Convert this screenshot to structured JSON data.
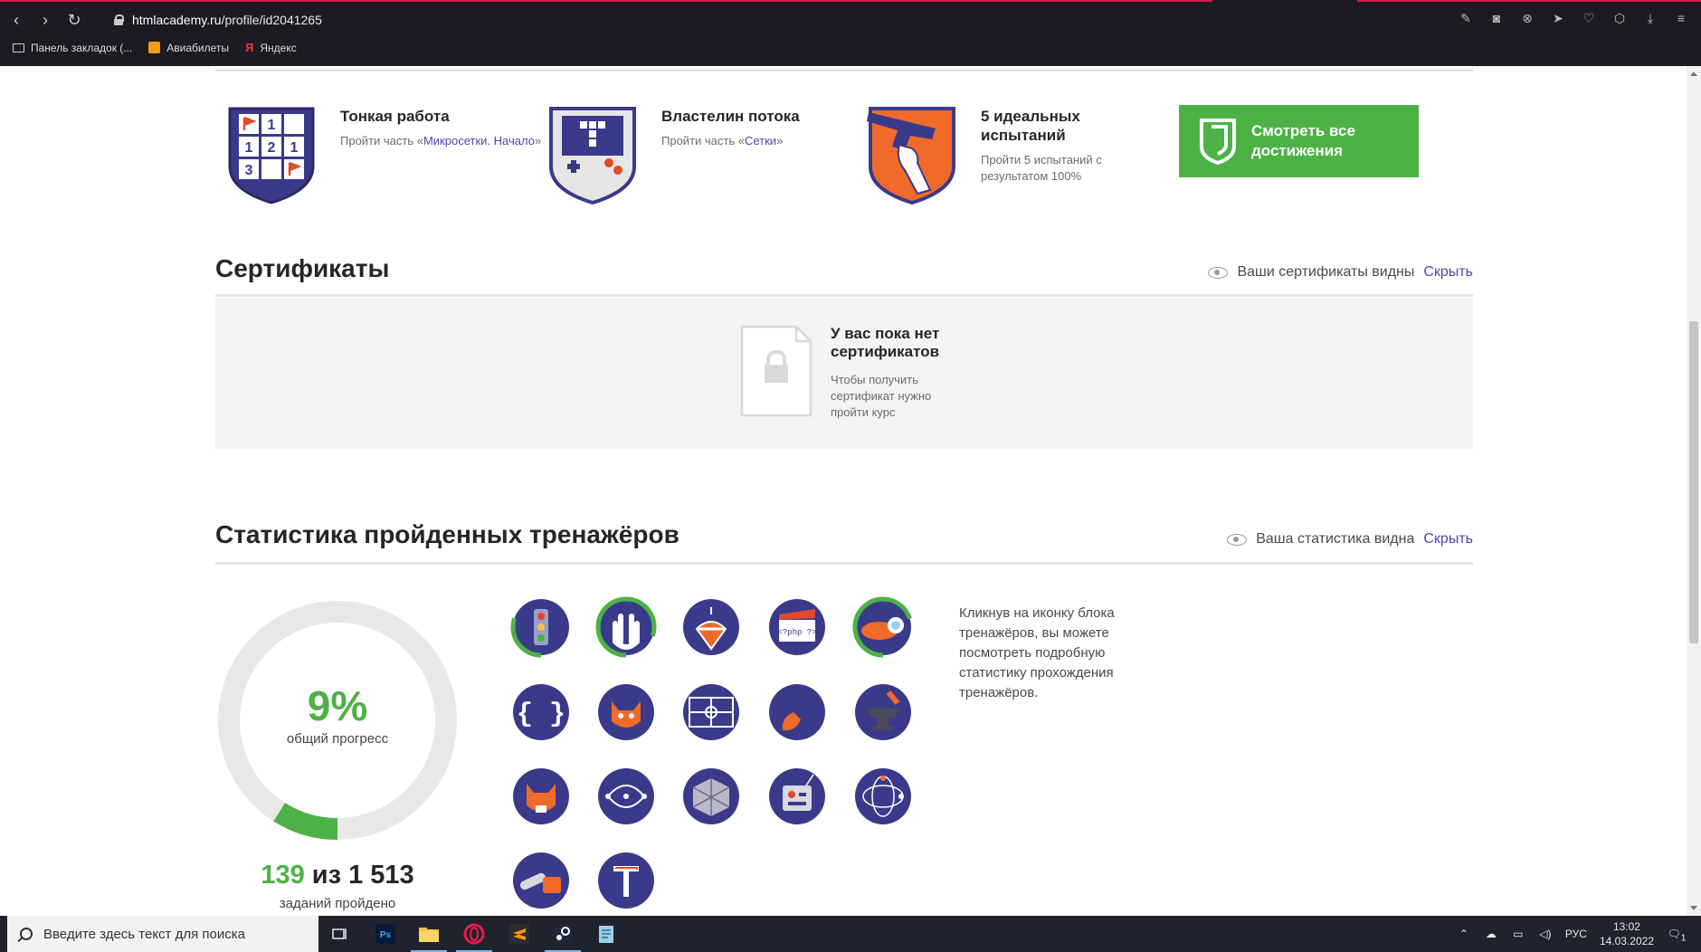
{
  "browser": {
    "url_host": "htmlacademy.ru",
    "url_path": "/profile/id2041265",
    "bookmarks": [
      {
        "label": "Панель закладок (..."
      },
      {
        "label": "Авиабилеты"
      },
      {
        "label": "Яндекс"
      }
    ]
  },
  "achievements": [
    {
      "title": "Тонкая работа",
      "desc_prefix": "Пройти часть «",
      "link": "Микросетки. Начало",
      "desc_suffix": "»",
      "icon": "minesweeper-badge-icon"
    },
    {
      "title": "Властелин потока",
      "desc_prefix": "Пройти часть «",
      "link": "Сетки",
      "desc_suffix": "»",
      "icon": "gameboy-badge-icon"
    },
    {
      "title": "5 идеальных испытаний",
      "desc": "Пройти 5 испытаний с результатом 100%",
      "icon": "pistol-badge-icon"
    }
  ],
  "all_achievements_button": "Смотреть все достижения",
  "certificates": {
    "title": "Сертификаты",
    "visibility": "Ваши сертификаты видны",
    "hide": "Скрыть",
    "empty_title": "У вас пока нет сертификатов",
    "empty_desc": "Чтобы получить сертификат нужно пройти курс"
  },
  "stats": {
    "title": "Статистика пройденных тренажёров",
    "visibility": "Ваша статистика видна",
    "hide": "Скрыть",
    "progress_percent": 9,
    "progress_text": "9%",
    "progress_label": "общий прогресс",
    "done": "139",
    "of_word": "из",
    "total": "1 513",
    "done_label": "заданий пройдено",
    "hint": "Кликнув на иконку блока тренажёров, вы можете посмотреть подробную статистику прохождения тренажёров.",
    "trainers": [
      {
        "icon": "traffic-light-icon",
        "progress": 0.3
      },
      {
        "icon": "vulcan-hand-icon",
        "progress": 0.8
      },
      {
        "icon": "spinning-top-icon",
        "progress": 0
      },
      {
        "icon": "php-clapper-icon",
        "progress": 0
      },
      {
        "icon": "submarine-icon",
        "progress": 0.7
      },
      {
        "icon": "curly-braces-icon",
        "progress": 0
      },
      {
        "icon": "fox-tea-icon",
        "progress": 0
      },
      {
        "icon": "sports-field-icon",
        "progress": 0
      },
      {
        "icon": "paint-brush-icon",
        "progress": 0
      },
      {
        "icon": "anvil-icon",
        "progress": 0
      },
      {
        "icon": "fox-cup-icon",
        "progress": 0
      },
      {
        "icon": "vector-path-icon",
        "progress": 0
      },
      {
        "icon": "cube-grid-icon",
        "progress": 0
      },
      {
        "icon": "remote-control-icon",
        "progress": 0
      },
      {
        "icon": "orbit-nodes-icon",
        "progress": 0
      },
      {
        "icon": "chainsaw-icon",
        "progress": 0
      },
      {
        "icon": "typography-t-icon",
        "progress": 0
      }
    ]
  },
  "taskbar": {
    "search_placeholder": "Введите здесь текст для поиска",
    "lang": "РУС",
    "time": "13:02",
    "date": "14.03.2022",
    "notifications": "1"
  }
}
